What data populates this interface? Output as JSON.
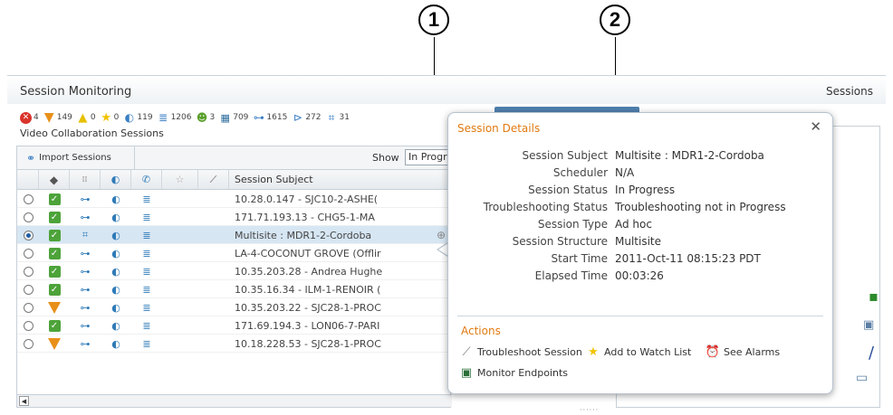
{
  "callouts": [
    "1",
    "2"
  ],
  "figure_id": "284168",
  "header": {
    "title": "Session Monitoring",
    "right_title": "Sessions"
  },
  "status_counts": [
    {
      "icon": "critical-alarm-icon",
      "count": "4"
    },
    {
      "icon": "major-alarm-icon",
      "count": "149"
    },
    {
      "icon": "minor-warning-icon",
      "count": "0"
    },
    {
      "icon": "warning-star-icon",
      "count": "0"
    },
    {
      "icon": "endpoint-icon",
      "count": "119"
    },
    {
      "icon": "router-icon",
      "count": "1206"
    },
    {
      "icon": "user-icon",
      "count": "3"
    },
    {
      "icon": "server-icon",
      "count": "709"
    },
    {
      "icon": "link-icon",
      "count": "1615"
    },
    {
      "icon": "switch-icon",
      "count": "272"
    },
    {
      "icon": "multipoint-icon",
      "count": "31"
    }
  ],
  "section_label": "Video Collaboration Sessions",
  "toolbar": {
    "import_label": "Import Sessions",
    "show_label": "Show",
    "show_value": "In Progress"
  },
  "columns": {
    "subject": "Session Subject"
  },
  "rows": [
    {
      "status": "ok",
      "structure": "point",
      "subject": "10.28.0.147 - SJC10-2-ASHE(",
      "selected": false
    },
    {
      "status": "ok",
      "structure": "point",
      "subject": "171.71.193.13 - CHG5-1-MA",
      "selected": false
    },
    {
      "status": "ok",
      "structure": "multi",
      "subject": "Multisite : MDR1-2-Cordoba",
      "selected": true
    },
    {
      "status": "ok",
      "structure": "point",
      "subject": "LA-4-COCONUT GROVE (Offlir",
      "selected": false
    },
    {
      "status": "ok",
      "structure": "point",
      "subject": "10.35.203.28 - Andrea Hughe",
      "selected": false
    },
    {
      "status": "ok",
      "structure": "point",
      "subject": "10.35.16.34 - ILM-1-RENOIR (",
      "selected": false
    },
    {
      "status": "warn",
      "structure": "point",
      "subject": "10.35.203.22 - SJC28-1-PROC",
      "selected": false
    },
    {
      "status": "ok",
      "structure": "point",
      "subject": "171.69.194.3 - LON06-7-PARI",
      "selected": false
    },
    {
      "status": "warn",
      "structure": "point",
      "subject": "10.18.228.53 - SJC28-1-PROC",
      "selected": false
    }
  ],
  "popup": {
    "title": "Session Details",
    "details": [
      {
        "key": "Session Subject",
        "value": "Multisite : MDR1-2-Cordoba"
      },
      {
        "key": "Scheduler",
        "value": "N/A"
      },
      {
        "key": "Session Status",
        "value": "In Progress"
      },
      {
        "key": "Troubleshooting Status",
        "value": "Troubleshooting not in Progress"
      },
      {
        "key": "Session Type",
        "value": "Ad hoc"
      },
      {
        "key": "Session Structure",
        "value": "Multisite"
      },
      {
        "key": "Start Time",
        "value": "2011-Oct-11 08:15:23 PDT"
      },
      {
        "key": "Elapsed Time",
        "value": "00:03:26"
      }
    ],
    "actions_title": "Actions",
    "actions": {
      "troubleshoot": "Troubleshoot Session",
      "watch": "Add to Watch List",
      "alarms": "See Alarms",
      "monitor": "Monitor Endpoints"
    }
  },
  "colors": {
    "accent_orange": "#e07a10",
    "ok_green": "#4da33a",
    "warn_orange": "#e8901a",
    "selection": "#d7e6f3"
  }
}
